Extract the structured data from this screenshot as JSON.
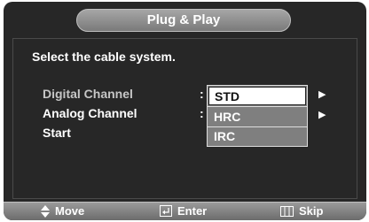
{
  "menu": {
    "title": "Plug & Play",
    "prompt": "Select the cable system."
  },
  "rows": [
    {
      "label": "Digital Channel",
      "separator": ":"
    },
    {
      "label": "Analog Channel",
      "separator": ":"
    },
    {
      "label": "Start"
    }
  ],
  "dropdown": {
    "options": [
      "STD",
      "HRC",
      "IRC"
    ],
    "selected": "STD"
  },
  "footer": {
    "move_label": "Move",
    "enter_label": "Enter",
    "skip_label": "Skip"
  },
  "colors": {
    "screen_bg": "#272727",
    "bar_gray": "#8a8a8a",
    "dropdown_gray": "#7f7f7f",
    "text": "#ffffff"
  },
  "icons": {
    "move": "updown-arrow-icon",
    "enter": "enter-icon",
    "skip": "menu-icon",
    "submenu": "right-triangle-icon"
  }
}
